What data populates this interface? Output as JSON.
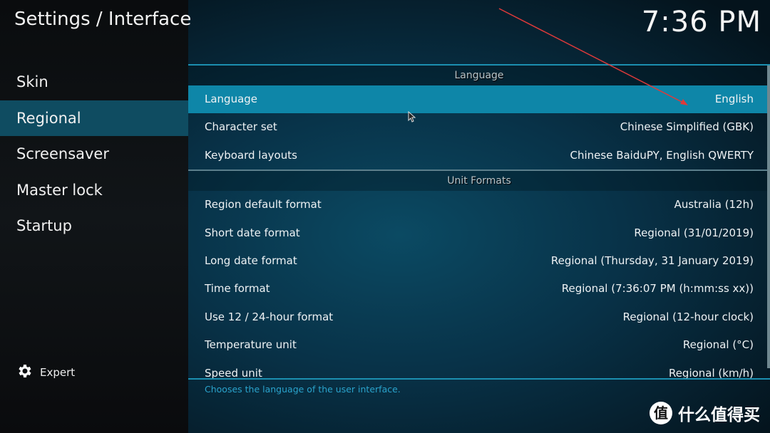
{
  "header": {
    "title": "Settings / Interface",
    "clock": "7:36 PM"
  },
  "sidebar": {
    "items": [
      {
        "label": "Skin"
      },
      {
        "label": "Regional",
        "active": true
      },
      {
        "label": "Screensaver"
      },
      {
        "label": "Master lock"
      },
      {
        "label": "Startup"
      }
    ],
    "expert_label": "Expert",
    "expert_icon": "gear-icon"
  },
  "groups": [
    {
      "header": "Language",
      "rows": [
        {
          "label": "Language",
          "value": "English",
          "focused": true
        },
        {
          "label": "Character set",
          "value": "Chinese Simplified (GBK)"
        },
        {
          "label": "Keyboard layouts",
          "value": "Chinese BaiduPY, English QWERTY"
        }
      ]
    },
    {
      "header": "Unit Formats",
      "rows": [
        {
          "label": "Region default format",
          "value": "Australia (12h)"
        },
        {
          "label": "Short date format",
          "value": "Regional (31/01/2019)"
        },
        {
          "label": "Long date format",
          "value": "Regional (Thursday, 31 January 2019)"
        },
        {
          "label": "Time format",
          "value": "Regional (7:36:07 PM (h:mm:ss xx))"
        },
        {
          "label": "Use 12 / 24-hour format",
          "value": "Regional (12-hour clock)"
        },
        {
          "label": "Temperature unit",
          "value": "Regional (°C)"
        },
        {
          "label": "Speed unit",
          "value": "Regional (km/h)"
        }
      ]
    }
  ],
  "help_text": "Chooses the language of the user interface.",
  "watermark": {
    "logo_char": "值",
    "text": "什么值得买"
  },
  "colors": {
    "accent": "#0e86a8",
    "sidebar_active": "#0f4c61",
    "help_text": "#2aa3cc",
    "annotation_arrow": "#e03a3a"
  }
}
